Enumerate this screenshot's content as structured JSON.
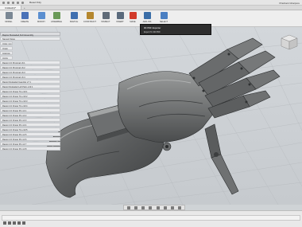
{
  "window": {
    "title": "Reset Only",
    "user": "Prashant Gharpure"
  },
  "tabs": [
    "Untitled(1)*"
  ],
  "toolbar": {
    "items": [
      {
        "label": "MODEL",
        "icon": "model-cube-icon",
        "color": "#7a8794"
      },
      {
        "label": "CREATE",
        "icon": "create-icon",
        "color": "#4a72b8"
      },
      {
        "label": "MODIFY",
        "icon": "modify-icon",
        "color": "#5b8fd0"
      },
      {
        "label": "ASSEMBLE",
        "icon": "assemble-icon",
        "color": "#6a9a58"
      },
      {
        "label": "SKETCH",
        "icon": "sketch-icon",
        "color": "#3f6fb0"
      },
      {
        "label": "CONSTRUCT",
        "icon": "construct-icon",
        "color": "#b5872e"
      },
      {
        "label": "INSPECT",
        "icon": "inspect-icon",
        "color": "#5f6b78"
      },
      {
        "label": "INSERT",
        "icon": "insert-icon",
        "color": "#5a6a7c"
      },
      {
        "label": "MAKE",
        "icon": "make-icon",
        "color": "#d23a2a"
      },
      {
        "label": "ADD-INS",
        "icon": "addins-icon",
        "color": "#3a6ea8"
      },
      {
        "label": "SELECT",
        "icon": "select-icon",
        "color": "#4a7fc2"
      }
    ]
  },
  "browser": {
    "title": "Raptor Reloaded Full Assembly",
    "rows": [
      "Named Views",
      "Units: mm",
      "Origin",
      "Analysis",
      "Joints",
      "Raptor 2.0 Proximal v6:1",
      "Raptor 2.0 Proximal v6:2",
      "Raptor 2.0 Proximal v6:3",
      "Raptor 2.0 Proximal v6:4",
      "Raptor Reloaded Gauntlet v7:1",
      "Raptor Reloaded Left Palm v13:1",
      "Raptor 2.0 Finger Tip v13:1",
      "Raptor 2.0 Finger Tip v13:2",
      "Raptor 2.0 Finger Tip v13:3",
      "Raptor 2.0 Finger Tip v13:4",
      "Raptor 2.0 Finger Pin v2:1",
      "Raptor 2.0 Finger Pin v2:2",
      "Raptor 2.0 Finger Pin v2:3",
      "Raptor 2.0 Finger Pin v2:4",
      "Raptor 2.0 Finger Tip v13:5",
      "Raptor 2.0 Finger Pin v2:5",
      "Raptor 2.0 Finger Pin v2:6",
      "Raptor 2.0 Finger Pin v2:7",
      "Raptor 2.0 Finger Pin v2:8"
    ]
  },
  "tooltip": {
    "heading": "3D PDF Exporter",
    "item": "Export To 3D PDF"
  },
  "nav_icons": [
    "orbit-icon",
    "pan-icon",
    "zoom-icon",
    "fit-icon",
    "look-at-icon",
    "display-icon",
    "grid-icon",
    "viewport-icon"
  ]
}
